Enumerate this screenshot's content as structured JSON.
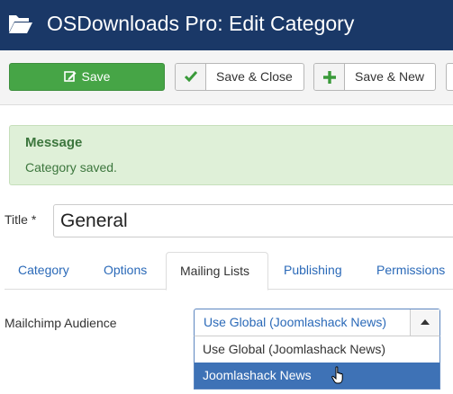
{
  "header": {
    "title": "OSDownloads Pro: Edit Category",
    "icon": "folder-open-icon"
  },
  "toolbar": {
    "save_label": "Save",
    "save_close_label": "Save & Close",
    "save_new_label": "Save & New",
    "colors": {
      "save_bg": "#46a546",
      "check": "#3a9a3a",
      "plus": "#3a9a3a"
    }
  },
  "message": {
    "heading": "Message",
    "text": "Category saved."
  },
  "form": {
    "title_label": "Title *",
    "title_value": "General"
  },
  "tabs": [
    {
      "label": "Category",
      "active": false
    },
    {
      "label": "Options",
      "active": false
    },
    {
      "label": "Mailing Lists",
      "active": true
    },
    {
      "label": "Publishing",
      "active": false
    },
    {
      "label": "Permissions",
      "active": false
    }
  ],
  "mailchimp": {
    "label": "Mailchimp Audience",
    "selected": "Use Global (Joomlashack News)",
    "options": [
      "Use Global (Joomlashack News)",
      "Joomlashack News"
    ],
    "highlighted_option": "Joomlashack News"
  },
  "colors": {
    "header_bg": "#1a3867",
    "link": "#2a69b8",
    "message_bg": "#dff0d8",
    "message_text": "#3c763d",
    "highlight_bg": "#3e72b6"
  }
}
